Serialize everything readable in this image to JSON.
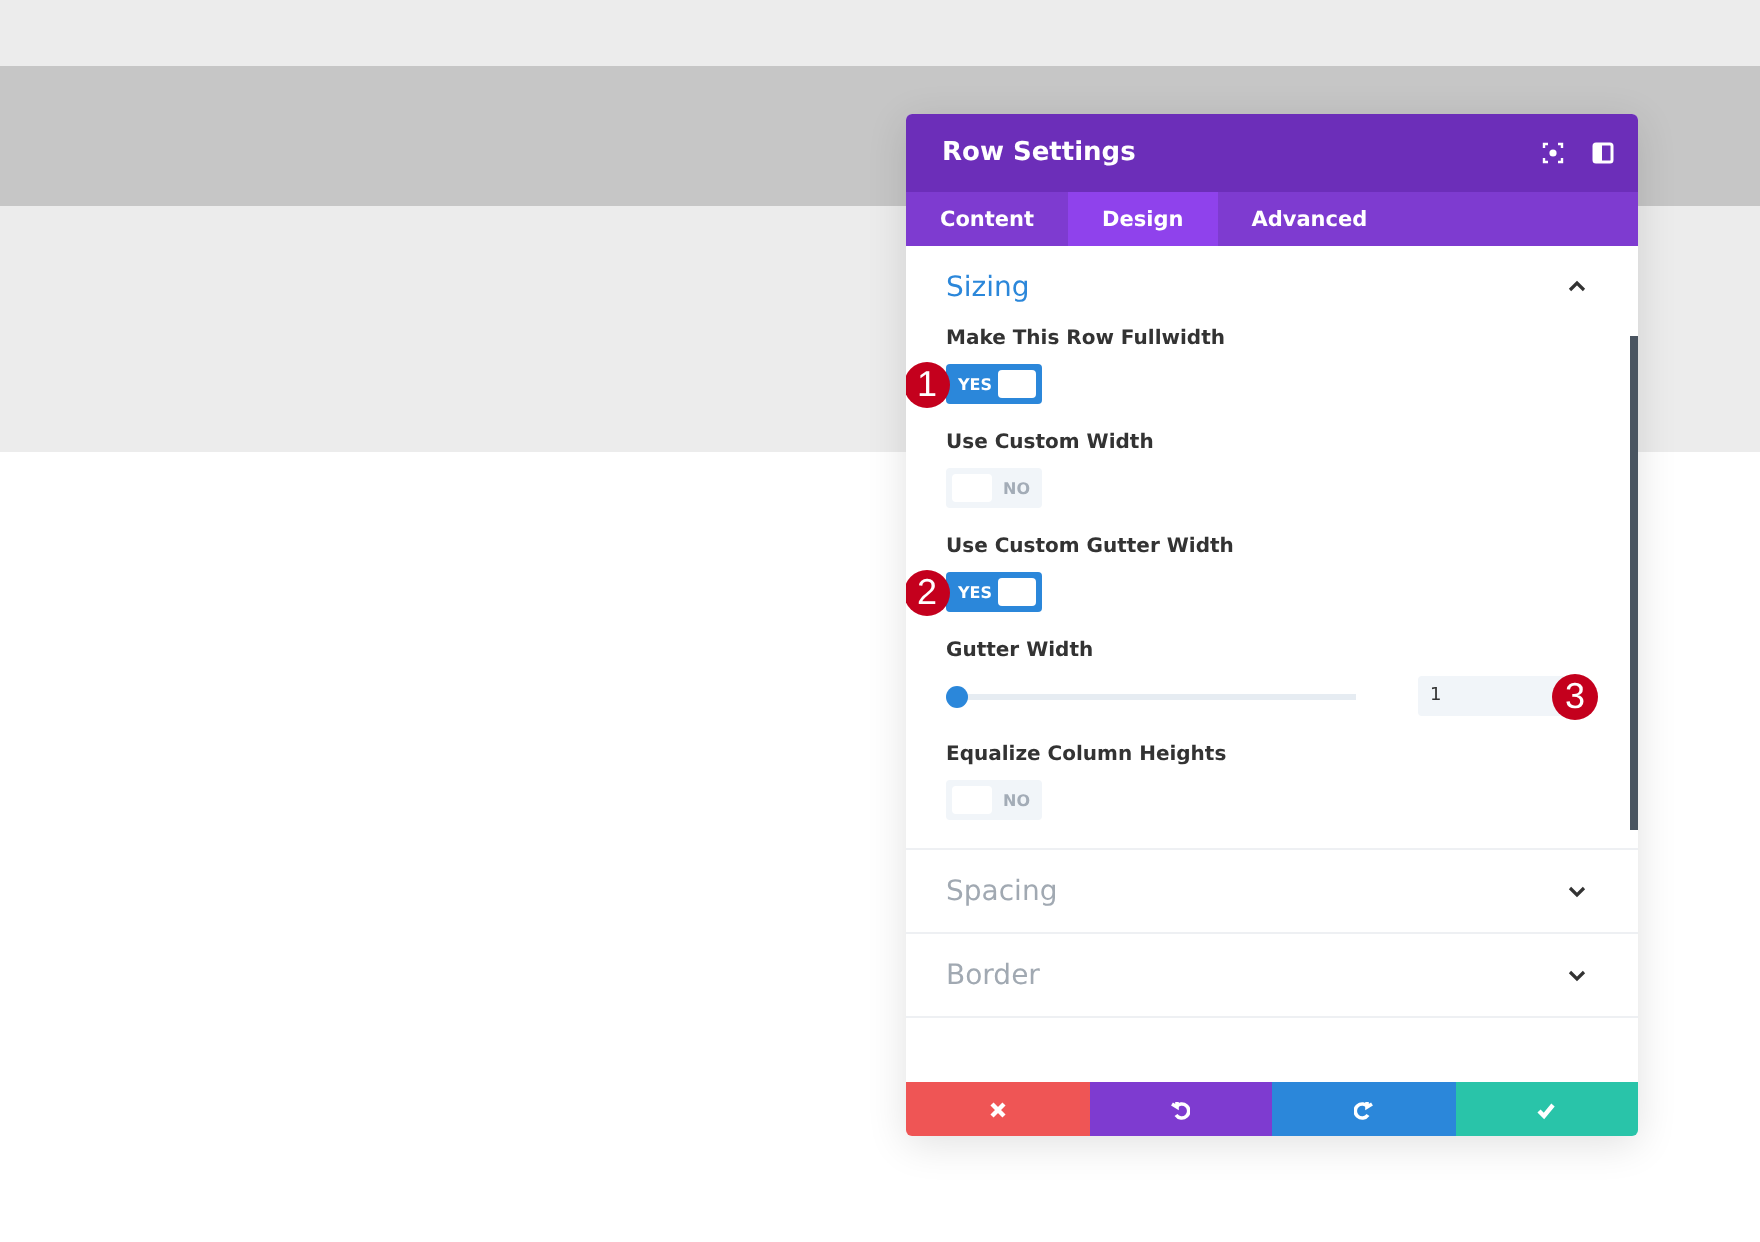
{
  "header": {
    "title": "Row Settings"
  },
  "tabs": [
    {
      "label": "Content",
      "selected": false
    },
    {
      "label": "Design",
      "selected": true
    },
    {
      "label": "Advanced",
      "selected": false
    }
  ],
  "sections": [
    {
      "title": "Sizing",
      "expanded": true,
      "fields": [
        {
          "kind": "toggle",
          "label": "Make This Row Fullwidth",
          "on": true,
          "value": "YES",
          "marker": "1"
        },
        {
          "kind": "toggle",
          "label": "Use Custom Width",
          "on": false,
          "value": "NO"
        },
        {
          "kind": "toggle",
          "label": "Use Custom Gutter Width",
          "on": true,
          "value": "YES",
          "marker": "2"
        },
        {
          "kind": "slider",
          "label": "Gutter Width",
          "level": 0,
          "value": "1",
          "marker": "3"
        },
        {
          "kind": "toggle",
          "label": "Equalize Column Heights",
          "on": false,
          "value": "NO"
        }
      ]
    },
    {
      "title": "Spacing",
      "expanded": false
    },
    {
      "title": "Border",
      "expanded": false
    }
  ],
  "actions": [
    {
      "kind": "discard"
    },
    {
      "kind": "undo"
    },
    {
      "kind": "redo"
    },
    {
      "kind": "save"
    }
  ]
}
